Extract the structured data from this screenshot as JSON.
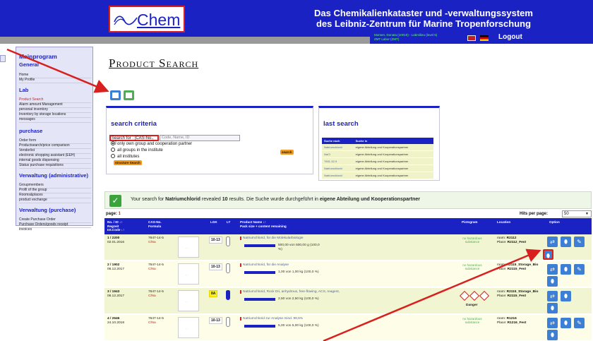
{
  "header": {
    "logo_text": "Chem",
    "title_line1": "Das Chemikalienkataster und -verwaltungssystem",
    "title_line2": "des Leibniz-Zentrum für Marine Tropenforschung",
    "user_line1": "Momen, Donata (10010) - Labmilieu (level 5)",
    "user_line2": "ZMT Labor (ZMT)",
    "logout_label": "Logout"
  },
  "sidebar": {
    "title": "Mainprogram",
    "general_title": "General",
    "general_items": [
      "Home",
      "My Profile"
    ],
    "lab_title": "Lab",
    "lab_items": [
      "Product Search",
      "Alarm amount Management",
      "personal inventory",
      "Inventory by storage locations",
      "messages"
    ],
    "purchase_title": "purchase",
    "purchase_items": [
      "Order form",
      "Productsearch/price comparison",
      "Vendorlist",
      "electronic shopping assistant (EEH)",
      "internal goods dispensing",
      "Status purchase requisitions"
    ],
    "admin_title": "Verwaltung (administrative)",
    "admin_items": [
      "Groupmembers",
      "Profil of the group",
      "Rooms&places",
      "product exchange"
    ],
    "vpurchase_title": "Verwaltung (purchase)",
    "vpurchase_items": [
      "Create Purchase Order",
      "Purchase Orders/goods receipt",
      "invoices"
    ]
  },
  "page": {
    "title": "Product Search"
  },
  "search": {
    "title": "search criteria",
    "label": "Search for : [CAS-No., ...]",
    "placeholder": "Code, Name, ID",
    "options": [
      "only own group and cooperation partner",
      "all groups in the institute",
      "all institutes"
    ],
    "selected_option": 0,
    "search_button": "search",
    "structure_button": "structure Search"
  },
  "last_search": {
    "title": "last search",
    "headers": [
      "Suche nach",
      "Suche in"
    ],
    "rows": [
      [
        "Natriumchlorid",
        "eigene Abteilung und Kooperationspartner"
      ],
      [
        "NaCl",
        "eigene Abteilung und Kooperationspartner"
      ],
      [
        "7651-32-9",
        "eigene Abteilung und Kooperationspartner"
      ],
      [
        "Natriumchlorid",
        "eigene Abteilung und Kooperationspartner"
      ],
      [
        "Natriumchlorid",
        "eigene Abteilung und Kooperationspartner"
      ]
    ]
  },
  "message": {
    "prefix": "Your search for ",
    "term": "Natriumchlorid",
    "middle": " revealed ",
    "count": "10",
    "suffix": " results. Die Suche wurde durchgeführt in ",
    "scope": "eigene Abteilung und Kooperationspartner"
  },
  "pager": {
    "label": "page: ",
    "current": "1",
    "hits_label": "Hits per page:",
    "hits_value": "50"
  },
  "results": {
    "headers": {
      "id": "No. / ID ↓↑",
      "regzeit": "Regzeit",
      "intcode": "Int.Code ↓↑",
      "cas": "CAS-No.",
      "formula": "Formula",
      "lgk": "LGK",
      "lt": "LT",
      "name": "Product Name ↓↑",
      "pack": "Pack size + content remaining",
      "picto": "Pictogram",
      "location": "Location",
      "option": "Option"
    },
    "rows": [
      {
        "id": "1 / 2200",
        "date": "02.01.2016",
        "cas": "7647-14-5",
        "formula": "ClNa",
        "lgk": "10-13",
        "name": "Natriumchlorid, für die Molekularbiologie",
        "amount": "500,00 von 500,00 g (100,0 %)",
        "fill": 1.0,
        "picto": "no hazardous substance",
        "room": "R2112",
        "place": "R2112_Fest"
      },
      {
        "id": "2 / 1902",
        "date": "06.12.2017",
        "cas": "7647-14-5",
        "formula": "ClNa",
        "lgk": "10-13",
        "name": "Natriumchlorid, für die Analyse",
        "amount": "1,00 von 1,00 kg (100,0 %)",
        "fill": 1.0,
        "picto": "no hazardous substance",
        "room": "R2115_Storage_Bio",
        "place": "R2115_Fest"
      },
      {
        "id": "3 / 1943",
        "date": "06.12.2017",
        "cas": "7647-14-5",
        "formula": "ClNa",
        "lgk": "8A",
        "name": "Natriumchlorid, Rock Dri, anhydrous, free-flowing, ACS, reagent,",
        "amount": "2,50 von 2,50 kg (100,0 %)",
        "fill": 1.0,
        "picto": "Danger",
        "room": "R2115_Storage_Bio",
        "place": "R2115_Fest"
      },
      {
        "id": "4 / 2646",
        "date": "24.10.2018",
        "cas": "7647-14-5",
        "formula": "ClNa",
        "lgk": "10-13",
        "name": "Natriumchlorid zur Analyse mind. 99,5%",
        "amount": "5,00 von 5,00 kg (100,0 %)",
        "fill": 1.0,
        "picto": "no hazardous substance",
        "room": "R1216",
        "place": "R1216_Fest"
      }
    ],
    "room_label": "room: ",
    "place_label": "Place: "
  },
  "colors": {
    "brand_blue": "#1b22c4",
    "highlight_red": "#d8201e",
    "row_green": "#f2f5d2",
    "accent_orange": "#f29a1d"
  }
}
